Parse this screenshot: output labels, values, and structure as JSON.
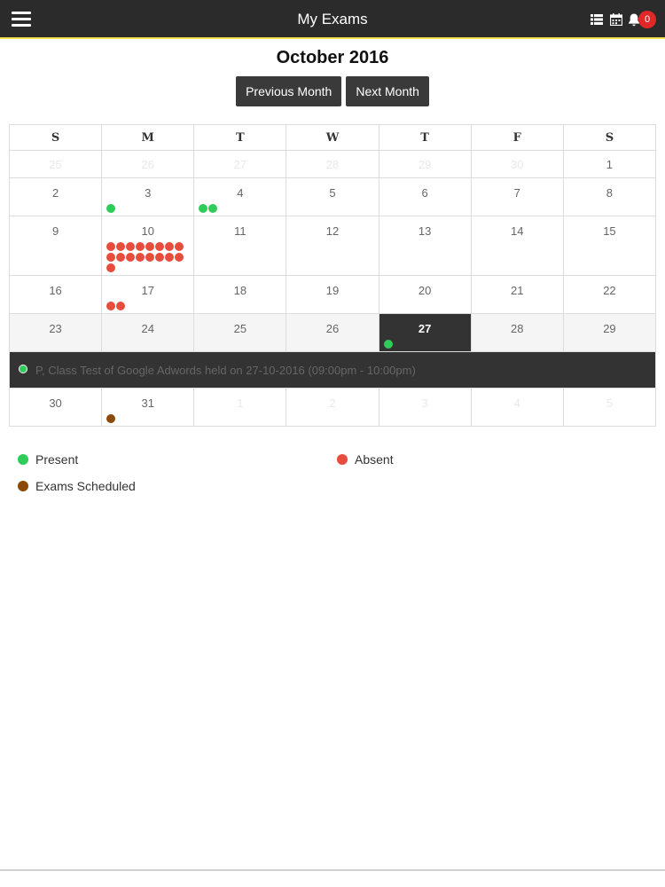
{
  "header": {
    "title": "My Exams",
    "notification_count": "0",
    "icons": [
      "menu-icon",
      "list-icon",
      "calendar-icon",
      "bell-icon"
    ]
  },
  "calendar": {
    "month_title": "October 2016",
    "prev_label": "Previous Month",
    "next_label": "Next Month",
    "weekdays": [
      "S",
      "M",
      "T",
      "W",
      "T",
      "F",
      "S"
    ],
    "weeks": [
      [
        {
          "day": "25",
          "muted": true
        },
        {
          "day": "26",
          "muted": true
        },
        {
          "day": "27",
          "muted": true
        },
        {
          "day": "28",
          "muted": true
        },
        {
          "day": "29",
          "muted": true
        },
        {
          "day": "30",
          "muted": true
        },
        {
          "day": "1"
        }
      ],
      [
        {
          "day": "2"
        },
        {
          "day": "3",
          "dots": [
            "present"
          ]
        },
        {
          "day": "4",
          "dots": [
            "present",
            "present"
          ]
        },
        {
          "day": "5"
        },
        {
          "day": "6"
        },
        {
          "day": "7"
        },
        {
          "day": "8"
        }
      ],
      [
        {
          "day": "9"
        },
        {
          "day": "10",
          "dots": [
            "absent",
            "absent",
            "absent",
            "absent",
            "absent",
            "absent",
            "absent",
            "absent",
            "absent",
            "absent",
            "absent",
            "absent",
            "absent",
            "absent",
            "absent",
            "absent",
            "absent"
          ]
        },
        {
          "day": "11"
        },
        {
          "day": "12"
        },
        {
          "day": "13"
        },
        {
          "day": "14"
        },
        {
          "day": "15"
        }
      ],
      [
        {
          "day": "16"
        },
        {
          "day": "17",
          "dots": [
            "absent",
            "absent"
          ]
        },
        {
          "day": "18"
        },
        {
          "day": "19"
        },
        {
          "day": "20"
        },
        {
          "day": "21"
        },
        {
          "day": "22"
        }
      ],
      [
        {
          "day": "23"
        },
        {
          "day": "24"
        },
        {
          "day": "25"
        },
        {
          "day": "26"
        },
        {
          "day": "27",
          "today": true,
          "dots": [
            "present"
          ]
        },
        {
          "day": "28"
        },
        {
          "day": "29"
        }
      ],
      [
        {
          "day": "30"
        },
        {
          "day": "31",
          "dots": [
            "scheduled"
          ]
        },
        {
          "day": "1",
          "muted": true
        },
        {
          "day": "2",
          "muted": true
        },
        {
          "day": "3",
          "muted": true
        },
        {
          "day": "4",
          "muted": true
        },
        {
          "day": "5",
          "muted": true
        }
      ]
    ],
    "event": {
      "status": "present",
      "text": "P, Class Test of Google Adwords held on 27-10-2016 (09:00pm - 10:00pm)"
    }
  },
  "legend": [
    {
      "label": "Present",
      "type": "present"
    },
    {
      "label": "Absent",
      "type": "absent"
    },
    {
      "label": "Exams Scheduled",
      "type": "scheduled"
    }
  ],
  "colors": {
    "present": "#2ecc58",
    "absent": "#e74c3c",
    "scheduled": "#8a4a0a",
    "header_bg": "#2b2b2b",
    "accent_line": "#f0e24a"
  }
}
